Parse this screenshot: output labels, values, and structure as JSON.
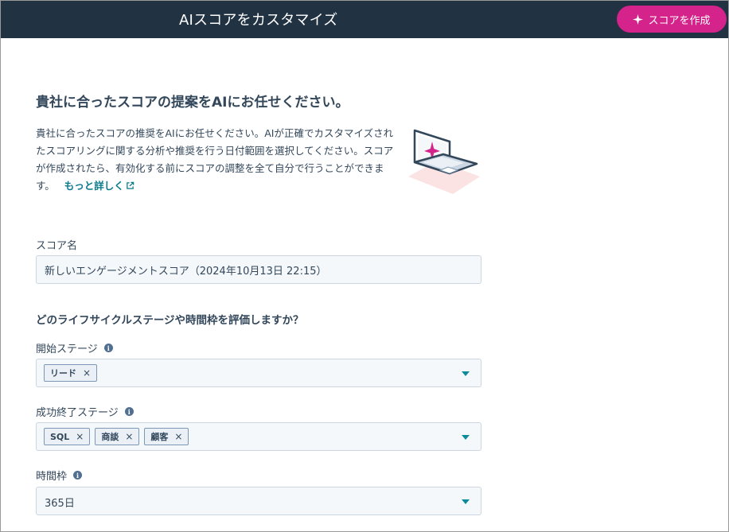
{
  "header": {
    "title": "AIスコアをカスタマイズ",
    "create_button_label": "スコアを作成"
  },
  "intro": {
    "heading": "貴社に合ったスコアの提案をAIにお任せください。",
    "description": "貴社に合ったスコアの推奨をAIにお任せください。AIが正確でカスタマイズされたスコアリングに関する分析や推奨を行う日付範囲を選択してください。スコアが作成されたら、有効化する前にスコアの調整を全て自分で行うことができます。",
    "learn_more": "もっと詳しく"
  },
  "score_name": {
    "label": "スコア名",
    "value": "新しいエンゲージメントスコア（2024年10月13日 22:15）"
  },
  "question": "どのライフサイクルステージや時間枠を評価しますか？",
  "start_stage": {
    "label": "開始ステージ",
    "tags": [
      "リード"
    ]
  },
  "success_stage": {
    "label": "成功終了ステージ",
    "tags": [
      "SQL",
      "商談",
      "顧客"
    ]
  },
  "timeframe": {
    "label": "時間枠",
    "value": "365日"
  },
  "colors": {
    "header_bg": "#213343",
    "accent": "#d4238a",
    "link": "#0b7a8c"
  }
}
